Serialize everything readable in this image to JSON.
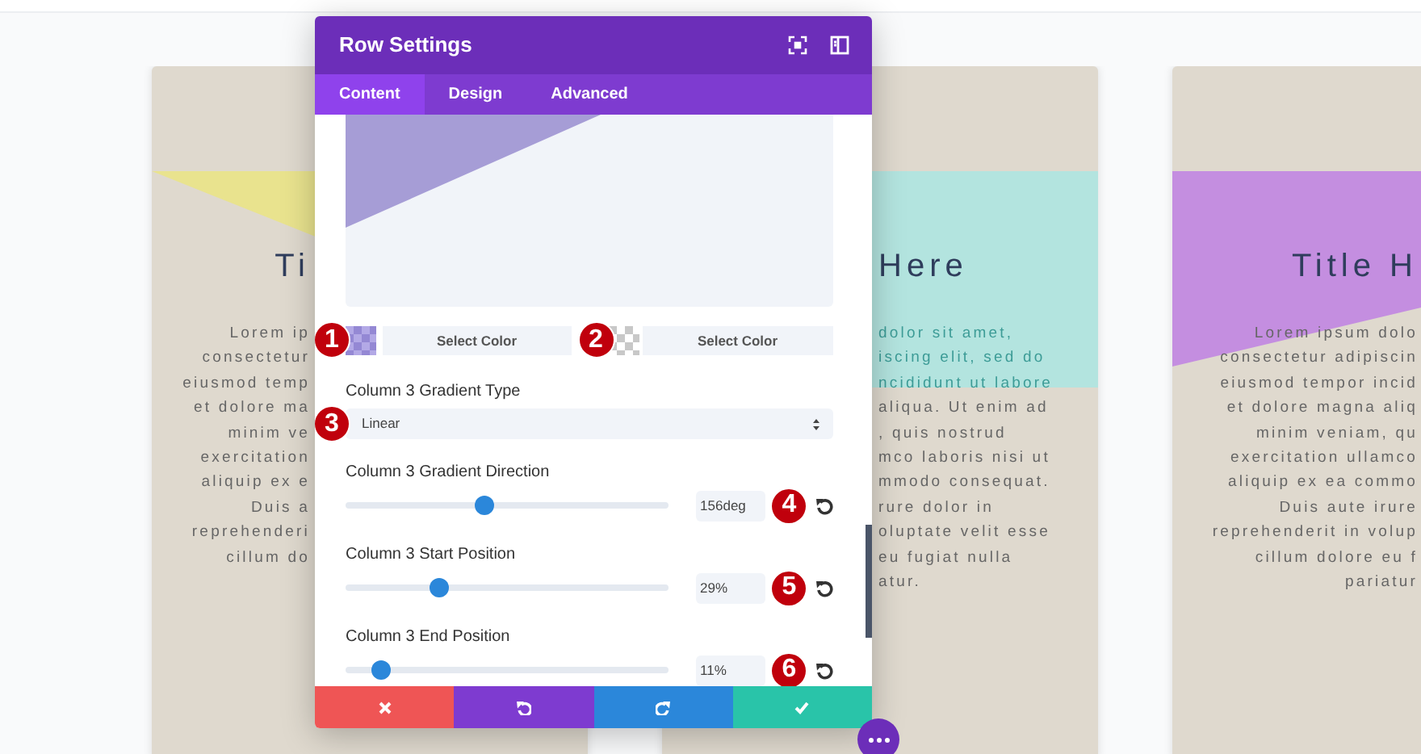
{
  "cards": [
    {
      "kind": "corner",
      "color": "#e9e38e",
      "title": "Ti",
      "lines": [
        {
          "text": "Lorem ip",
          "tinted": false
        },
        {
          "text": "consectetur",
          "tinted": false
        },
        {
          "text": "eiusmod temp",
          "tinted": false
        },
        {
          "text": "et dolore ma",
          "tinted": false
        },
        {
          "text": "minim ve",
          "tinted": false
        },
        {
          "text": "exercitation",
          "tinted": false
        },
        {
          "text": "aliquip ex e",
          "tinted": false
        },
        {
          "text": "Duis a",
          "tinted": false
        },
        {
          "text": "reprehenderi",
          "tinted": false
        },
        {
          "text": "cillum do",
          "tinted": false
        }
      ]
    },
    {
      "kind": "band",
      "color": "#b3e4df",
      "title": "Here",
      "lines": [
        {
          "text": "dolor sit amet,",
          "tinted": true
        },
        {
          "text": "iscing elit, sed do",
          "tinted": true
        },
        {
          "text": "ncididunt ut labore",
          "tinted": true
        },
        {
          "text": "aliqua. Ut enim ad",
          "tinted": false
        },
        {
          "text": ", quis nostrud",
          "tinted": false
        },
        {
          "text": "mco laboris nisi ut",
          "tinted": false
        },
        {
          "text": "mmodo consequat.",
          "tinted": false
        },
        {
          "text": "rure dolor in",
          "tinted": false
        },
        {
          "text": "oluptate velit esse",
          "tinted": false
        },
        {
          "text": "eu fugiat nulla",
          "tinted": false
        },
        {
          "text": "atur.",
          "tinted": false
        }
      ]
    },
    {
      "kind": "wedge",
      "color": "#c48ee0",
      "title": "Title H",
      "lines": [
        {
          "text": "Lorem ipsum dolo",
          "tinted": false
        },
        {
          "text": "consectetur adipiscin",
          "tinted": false
        },
        {
          "text": "eiusmod tempor incid",
          "tinted": false
        },
        {
          "text": "et dolore magna aliq",
          "tinted": false
        },
        {
          "text": "minim veniam, qu",
          "tinted": false
        },
        {
          "text": "exercitation ullamco",
          "tinted": false
        },
        {
          "text": "aliquip ex ea commo",
          "tinted": false
        },
        {
          "text": "Duis aute irure",
          "tinted": false
        },
        {
          "text": "reprehenderit in volup",
          "tinted": false
        },
        {
          "text": "cillum dolore eu f",
          "tinted": false
        },
        {
          "text": "pariatur",
          "tinted": false
        }
      ]
    }
  ],
  "modal": {
    "title": "Row Settings",
    "tabs": [
      {
        "label": "Content",
        "selected": true
      },
      {
        "label": "Design",
        "selected": false
      },
      {
        "label": "Advanced",
        "selected": false
      }
    ],
    "color_pickers": [
      {
        "marker": "1",
        "kind": "filled",
        "color": "#9488d4",
        "button": "Select Color"
      },
      {
        "marker": "2",
        "kind": "empty",
        "button": "Select Color"
      }
    ],
    "gradient_type": {
      "label": "Column 3 Gradient Type",
      "value": "Linear",
      "marker": "3"
    },
    "sliders": [
      {
        "label": "Column 3 Gradient Direction",
        "level": 0.43,
        "value": "156deg",
        "marker": "4"
      },
      {
        "label": "Column 3 Start Position",
        "level": 0.29,
        "value": "29%",
        "marker": "5"
      },
      {
        "label": "Column 3 End Position",
        "level": 0.11,
        "value": "11%",
        "marker": "6"
      }
    ],
    "footer_buttons": [
      {
        "kind": "cancel"
      },
      {
        "kind": "undo"
      },
      {
        "kind": "redo"
      },
      {
        "kind": "save"
      }
    ]
  }
}
